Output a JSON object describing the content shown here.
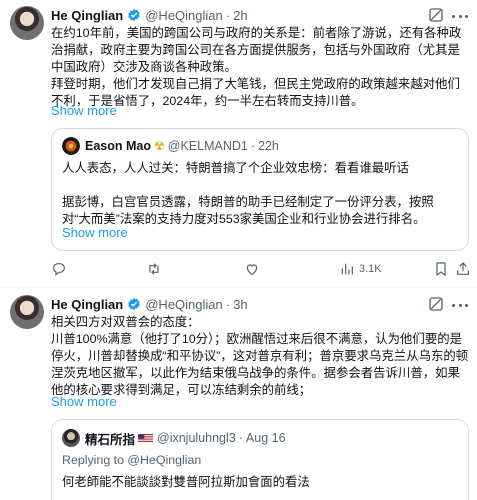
{
  "tweet1": {
    "name": "He Qinglian",
    "handle": "@HeQinglian",
    "dot": "·",
    "time": "2h",
    "text": "在约10年前，美国的跨国公司与政府的关系是：前者除了游说，还有各种政治捐献，政府主要为跨国公司在各方面提供服务，包括与外国政府（尤其是中国政府）交涉及商谈各种政策。\n拜登时期，他们才发现自己捐了大笔钱，但民主党政府的政策越来越对他们不利，于是省悟了，2024年，约一半左右转而支持川普。",
    "show_more": "Show more",
    "quote": {
      "name": "Eason Mao",
      "badge": "☢",
      "handle": "@KELMAND1",
      "dot": "·",
      "time": "22h",
      "text": "人人表态，人人过关：特朗普搞了个企业效忠榜：看看谁最听话\n\n据彭博，白宫官员透露，特朗普的助手已经制定了一份评分表，按照对“大而美”法案的支持力度对553家美国企业和行业协会进行排名。",
      "show_more": "Show more"
    },
    "actions": {
      "views": "3.1K"
    }
  },
  "tweet2": {
    "name": "He Qinglian",
    "handle": "@HeQinglian",
    "dot": "·",
    "time": "3h",
    "text": "相关四方对双普会的态度：\n川普100%满意（他打了10分）；欧洲醒悟过来后很不满意，认为他们要的是停火，川普却替换成“和平协议”，这对普京有利；普京要求乌克兰从乌东的顿涅茨克地区撤军，以此作为结束俄乌战争的条件。据参会者告诉川普，如果他的核心要求得到满足，可以冻结剩余的前线；",
    "show_more": "Show more",
    "quote": {
      "name": "精石所指",
      "handle": "@ixnjuluhngl3",
      "dot": "·",
      "time": "Aug 16",
      "replying": "Replying to @HeQinglian",
      "text": "何老師能不能談談對雙普阿拉斯加會面的看法"
    }
  },
  "colors": {
    "accent": "#1d9bf0",
    "muted": "#536471",
    "border": "#cfd9de"
  },
  "icons": [
    "verified-badge-icon",
    "grok-icon",
    "more-icon",
    "reply-icon",
    "retweet-icon",
    "like-icon",
    "views-icon",
    "bookmark-icon",
    "share-icon",
    "us-flag-icon"
  ]
}
